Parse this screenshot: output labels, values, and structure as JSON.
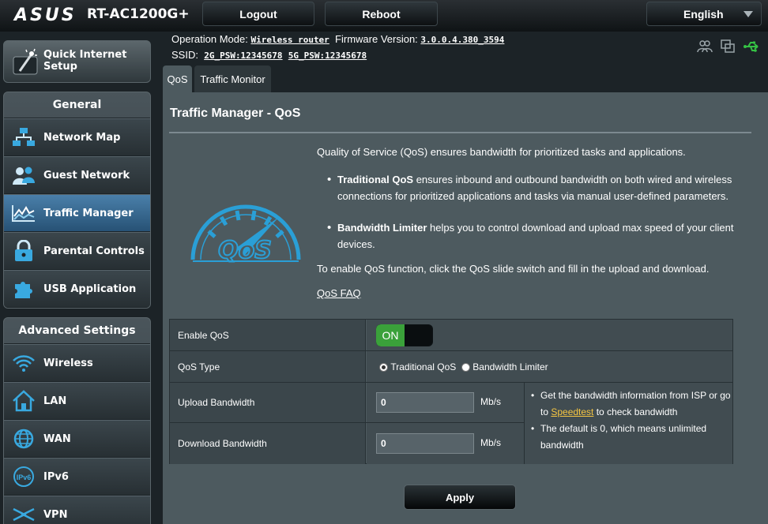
{
  "header": {
    "brand": "ASUS",
    "model": "RT-AC1200G+",
    "logout_label": "Logout",
    "reboot_label": "Reboot",
    "language": "English"
  },
  "info": {
    "op_mode_label": "Operation Mode:",
    "op_mode_value": "Wireless router",
    "firmware_label": "Firmware Version:",
    "firmware_value": "3.0.0.4.380_3594",
    "ssid_label": "SSID:",
    "ssid_2g": "2G_PSW:12345678",
    "ssid_5g": "5G_PSW:12345678"
  },
  "sidebar": {
    "quick_setup_line1": "Quick Internet",
    "quick_setup_line2": "Setup",
    "general_title": "General",
    "general_items": [
      {
        "label": "Network Map",
        "icon": "network-map-icon"
      },
      {
        "label": "Guest Network",
        "icon": "guest-network-icon"
      },
      {
        "label": "Traffic Manager",
        "icon": "traffic-manager-icon",
        "active": true
      },
      {
        "label": "Parental Controls",
        "icon": "lock-icon"
      },
      {
        "label": "USB Application",
        "icon": "puzzle-icon"
      }
    ],
    "advanced_title": "Advanced Settings",
    "advanced_items": [
      {
        "label": "Wireless",
        "icon": "wifi-icon"
      },
      {
        "label": "LAN",
        "icon": "house-icon"
      },
      {
        "label": "WAN",
        "icon": "globe-icon"
      },
      {
        "label": "IPv6",
        "icon": "ipv6-icon"
      },
      {
        "label": "VPN",
        "icon": "vpn-icon"
      }
    ]
  },
  "tabs": [
    {
      "label": "QoS",
      "active": true
    },
    {
      "label": "Traffic Monitor",
      "active": false
    }
  ],
  "main": {
    "title": "Traffic Manager - QoS",
    "logo_text": "QoS",
    "intro": "Quality of Service (QoS) ensures bandwidth for prioritized tasks and applications.",
    "bullet1_bold": "Traditional QoS",
    "bullet1_text": " ensures inbound and outbound bandwidth on both wired and wireless connections for prioritized applications and tasks via manual user-defined parameters.",
    "bullet2_bold": "Bandwidth Limiter",
    "bullet2_text": " helps you to control download and upload max speed of your client devices.",
    "enable_text": "To enable QoS function, click the QoS slide switch and fill in the upload and download.",
    "faq_link": "QoS FAQ"
  },
  "form": {
    "enable_label": "Enable QoS",
    "toggle_on": "ON",
    "qos_type_label": "QoS Type",
    "option_traditional": "Traditional QoS",
    "option_limiter": "Bandwidth Limiter",
    "selected_type": "Traditional QoS",
    "upload_label": "Upload Bandwidth",
    "upload_value": "0",
    "download_label": "Download Bandwidth",
    "download_value": "0",
    "unit": "Mb/s",
    "note1_a": "Get the bandwidth information from ISP or go to ",
    "note1_link": "Speedtest",
    "note1_b": " to check bandwidth",
    "note2": "The default is 0, which means unlimited bandwidth",
    "apply_label": "Apply"
  },
  "colors": {
    "accent_blue": "#2a9fd6",
    "toggle_green": "#3aa13a",
    "link_yellow": "#f5c542"
  }
}
